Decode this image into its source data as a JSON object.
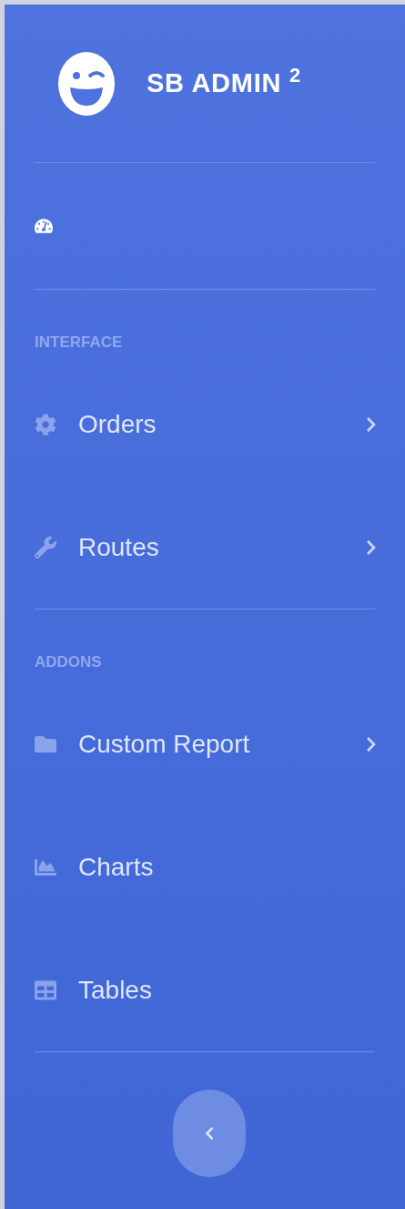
{
  "brand": {
    "title": "SB ADMIN $^{2}$"
  },
  "sections": [
    {
      "heading": "INTERFACE",
      "items": [
        {
          "label": "Orders",
          "expandable": true
        },
        {
          "label": "Routes",
          "expandable": true
        }
      ]
    },
    {
      "heading": "ADDONS",
      "items": [
        {
          "label": "Custom Report",
          "expandable": true
        },
        {
          "label": "Charts",
          "expandable": false
        },
        {
          "label": "Tables",
          "expandable": false
        }
      ]
    }
  ]
}
